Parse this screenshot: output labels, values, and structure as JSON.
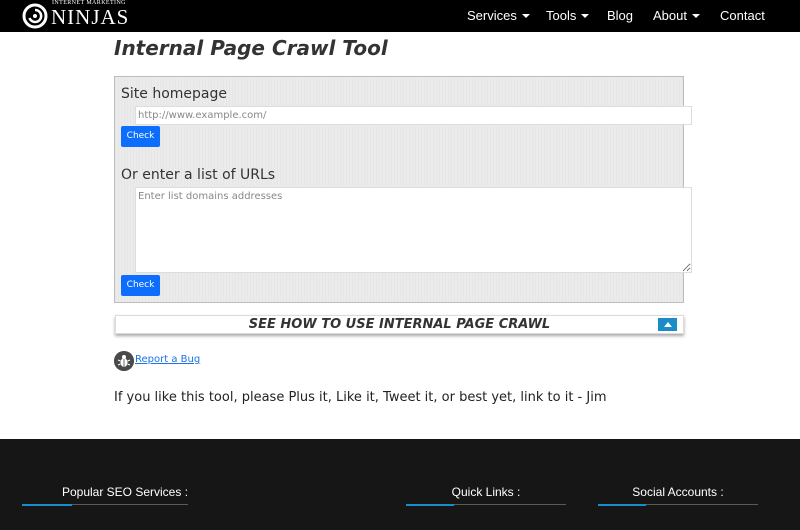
{
  "header": {
    "logo_small": "INTERNET MARKETING",
    "logo_big": "NINJAS",
    "nav": [
      {
        "label": "Services",
        "dropdown": true
      },
      {
        "label": "Tools",
        "dropdown": true
      },
      {
        "label": "Blog",
        "dropdown": false
      },
      {
        "label": "About",
        "dropdown": true
      },
      {
        "label": "Contact",
        "dropdown": false
      }
    ]
  },
  "main": {
    "title": "Internal Page Crawl Tool",
    "form": {
      "homepage_label": "Site homepage",
      "homepage_placeholder": "http://www.example.com/",
      "check_label": "Check",
      "list_label": "Or enter a list of URLs",
      "list_placeholder": "Enter list domains addresses"
    },
    "howto": {
      "text": "SEE HOW TO USE INTERNAL PAGE CRAWL"
    },
    "bug_link": "Report a Bug",
    "cta": "If you like this tool, please Plus it, Like it, Tweet it, or best yet, link to it - Jim"
  },
  "footer": {
    "headings": [
      "Popular SEO Services :",
      "Quick Links :",
      "Social Accounts :"
    ]
  },
  "colors": {
    "navbar": "#000000",
    "accent": "#0d6efd",
    "footer": "#161616",
    "footer_accent": "#1a8cc8"
  },
  "icons": {
    "logo": "ninja-swirl-icon",
    "dropdown": "caret-down-icon",
    "collapse": "chevron-up-icon",
    "bug": "bug-icon"
  }
}
